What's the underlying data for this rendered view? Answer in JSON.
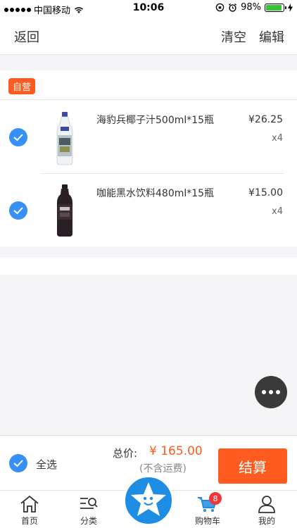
{
  "status_bar": {
    "carrier": "中国移动",
    "time": "10:06",
    "battery": "98%"
  },
  "navbar": {
    "back": "返回",
    "clear": "清空",
    "edit": "编辑"
  },
  "shop": {
    "tag": "自营"
  },
  "items": [
    {
      "name": "海豹兵椰子汁500ml*15瓶",
      "price": "¥26.25",
      "qty": "x4",
      "checked": true
    },
    {
      "name": "咖能黑水饮料480ml*15瓶",
      "price": "¥15.00",
      "qty": "x4",
      "checked": true
    }
  ],
  "checkout": {
    "select_all": "全选",
    "total_label": "总价:",
    "total_value": "¥ 165.00",
    "shipping_note": "(不含运费)",
    "button": "结算"
  },
  "tabbar": {
    "home": "首页",
    "category": "分类",
    "cart": "购物车",
    "cart_badge": "8",
    "mine": "我的"
  },
  "colors": {
    "accent": "#ff5a1f",
    "check": "#3790f5",
    "tab_brand": "#1e8ee4"
  }
}
